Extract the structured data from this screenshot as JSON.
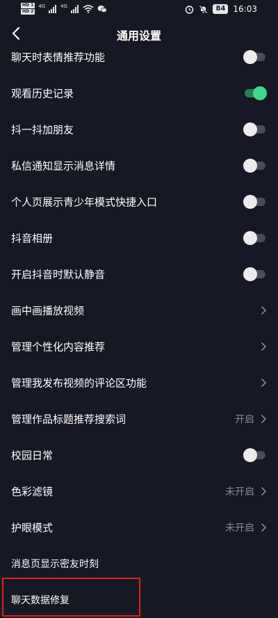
{
  "status_bar": {
    "hd1": "HD 1",
    "hd2": "HD 2",
    "net1": "4G",
    "net2": "4G",
    "battery": "84",
    "time": "16:03"
  },
  "header": {
    "title": "通用设置"
  },
  "settings": [
    {
      "label": "聊天时表情推荐功能",
      "control": "toggle",
      "on": false
    },
    {
      "label": "观看历史记录",
      "control": "toggle",
      "on": true
    },
    {
      "label": "抖一抖加朋友",
      "control": "toggle",
      "on": false
    },
    {
      "label": "私信通知显示消息详情",
      "control": "toggle",
      "on": false
    },
    {
      "label": "个人页展示青少年模式快捷入口",
      "control": "toggle",
      "on": false
    },
    {
      "label": "抖音相册",
      "control": "toggle",
      "on": false
    },
    {
      "label": "开启抖音时默认静音",
      "control": "toggle",
      "on": false
    },
    {
      "label": "画中画播放视频",
      "control": "chevron"
    },
    {
      "label": "管理个性化内容推荐",
      "control": "chevron"
    },
    {
      "label": "管理我发布视频的评论区功能",
      "control": "chevron"
    },
    {
      "label": "管理作品标题推荐搜索词",
      "control": "chevron",
      "value": "开启"
    },
    {
      "label": "校园日常",
      "control": "toggle",
      "on": false
    },
    {
      "label": "色彩滤镜",
      "control": "chevron",
      "value": "未开启"
    },
    {
      "label": "护眼模式",
      "control": "chevron",
      "value": "未开启"
    },
    {
      "label": "消息页显示密友时刻",
      "control": "none"
    },
    {
      "label": "聊天数据修复",
      "control": "none",
      "highlighted": true
    }
  ],
  "colors": {
    "background": "#161823",
    "toggle_on": "#3fd78c",
    "highlight": "#e02020"
  }
}
